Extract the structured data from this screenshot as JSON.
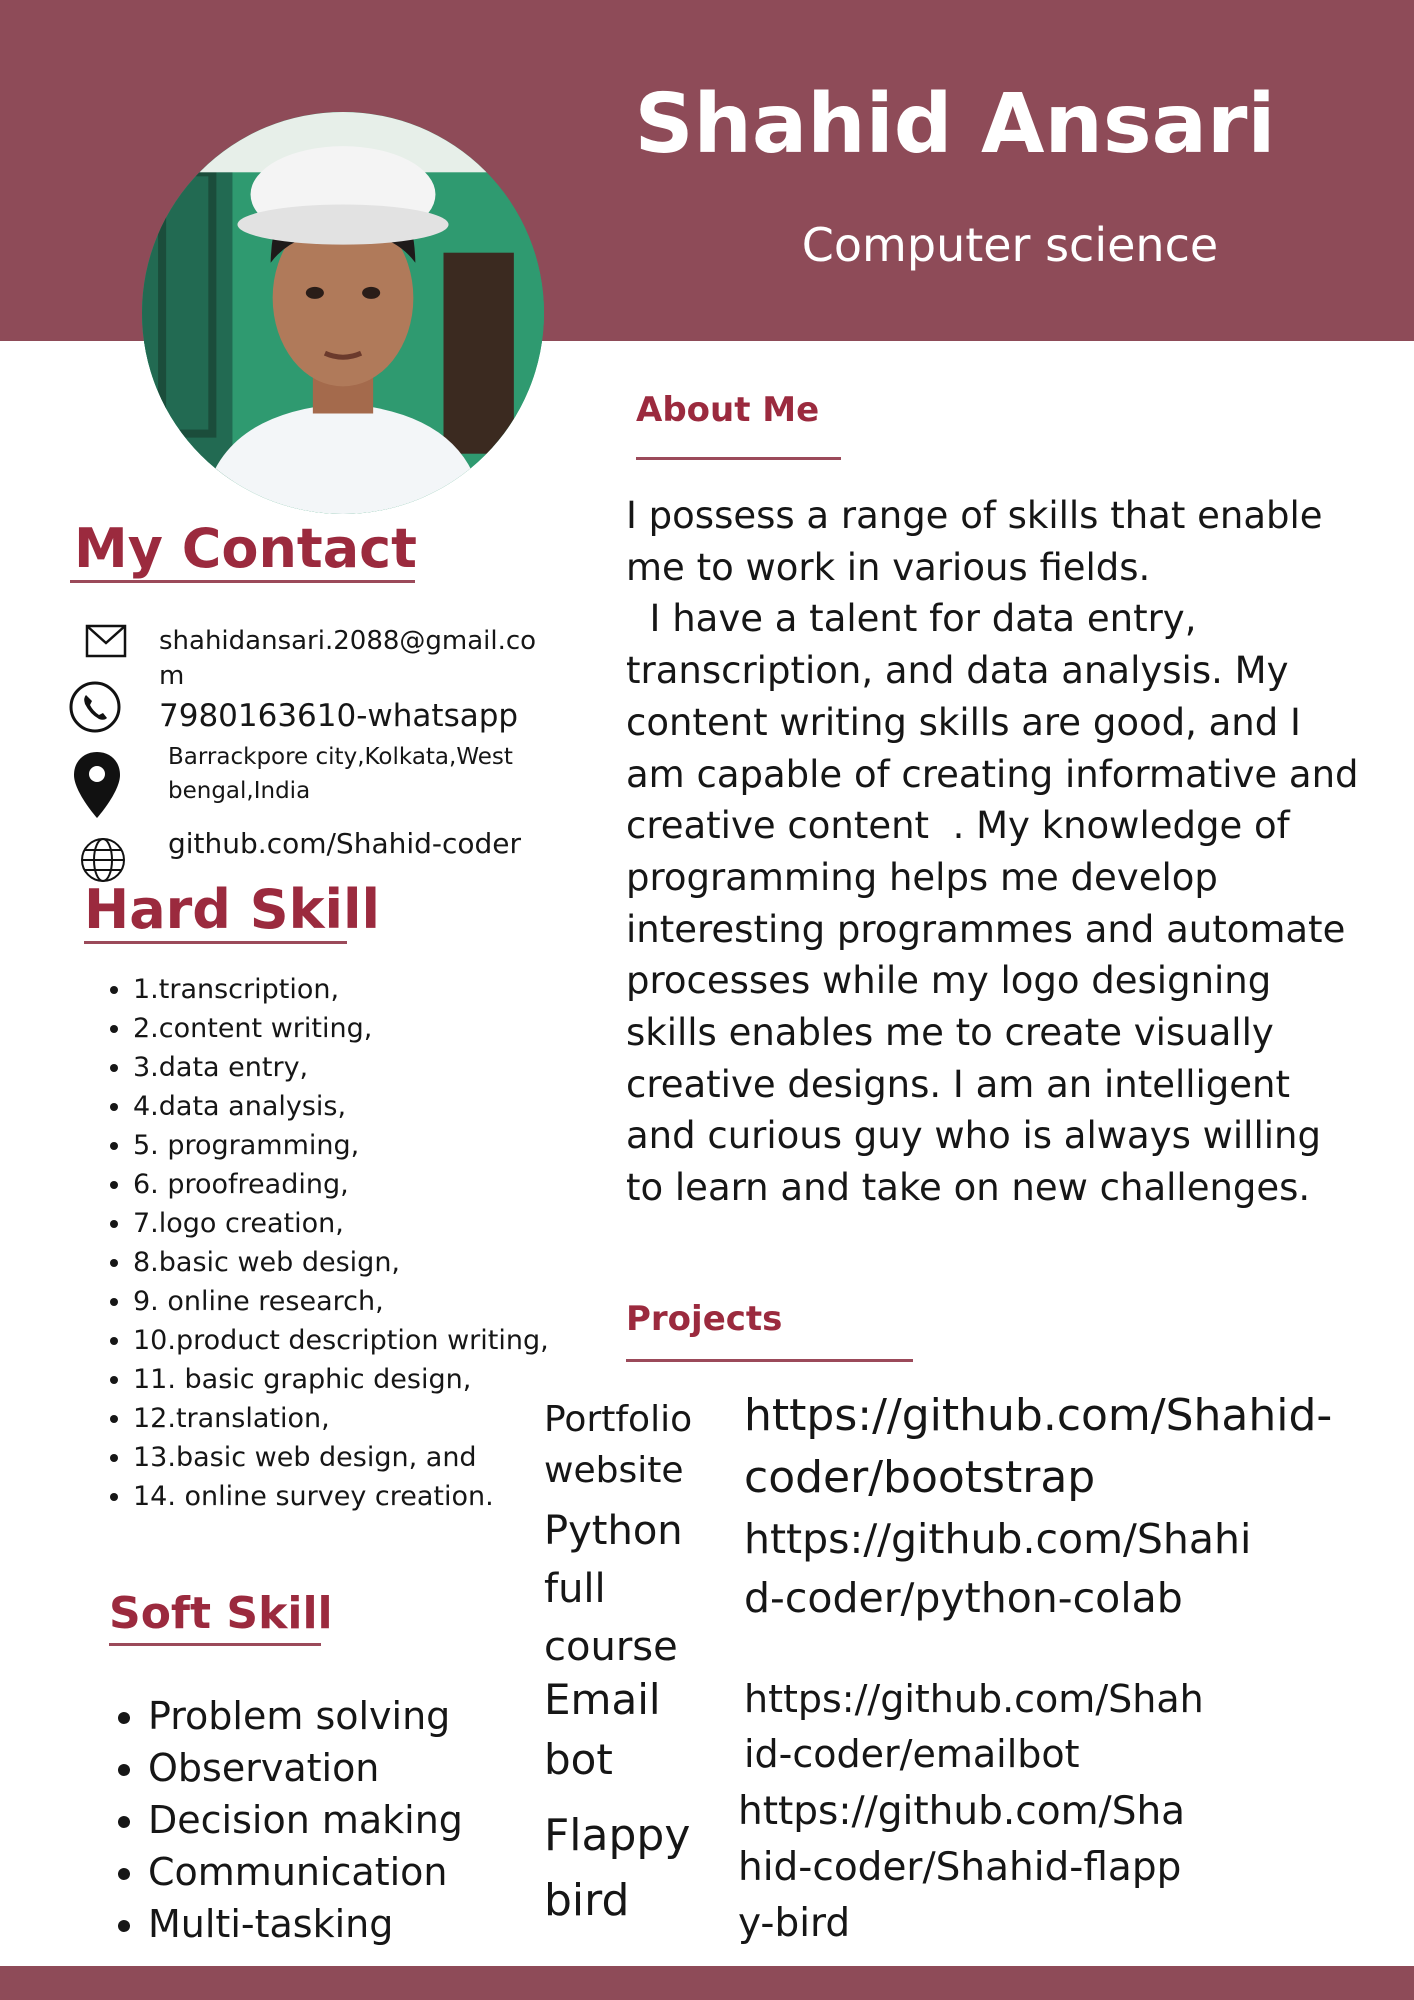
{
  "header": {
    "name": "Shahid Ansari",
    "title": "Computer science"
  },
  "colors": {
    "accent": "#8e4b58",
    "heading": "#9b2a3e"
  },
  "contact": {
    "heading": "My Contact",
    "email": "shahidansari.2088@gmail.com",
    "phone": "7980163610-whatsapp",
    "address": "Barrackpore city,Kolkata,West bengal,India",
    "website": "github.com/Shahid-coder",
    "icons": [
      "mail-icon",
      "phone-icon",
      "location-pin-icon",
      "globe-icon"
    ]
  },
  "hard_skill": {
    "heading": "Hard Skill",
    "items": [
      "1.transcription,",
      "2.content writing,",
      "3.data entry,",
      "4.data analysis,",
      "5. programming,",
      "6. proofreading,",
      "7.logo creation,",
      "8.basic web design,",
      "9. online research,",
      "10.product description writing,",
      "11. basic graphic design,",
      "12.translation,",
      "13.basic web design, and",
      "14. online survey creation."
    ]
  },
  "soft_skill": {
    "heading": "Soft Skill",
    "items": [
      "Problem solving",
      "Observation",
      "Decision making",
      "Communication",
      "Multi-tasking"
    ]
  },
  "about": {
    "heading": "About Me",
    "text": "I possess a range of skills that enable me to work in various fields.\n  I have a talent for data entry, transcription, and data analysis. My content writing skills are good, and I am capable of creating informative and creative content  . My knowledge of programming helps me develop interesting programmes and automate processes while my logo designing skills enables me to create visually creative designs. I am an intelligent and curious guy who is always willing to learn and take on new challenges."
  },
  "projects": {
    "heading": "Projects",
    "items": [
      {
        "name": "Portfolio website",
        "link": "https://github.com/Shahid-coder/bootstrap"
      },
      {
        "name": "Python full course",
        "link": "https://github.com/Shahid-coder/python-colab"
      },
      {
        "name": "Email bot",
        "link": "https://github.com/Shahid-coder/emailbot"
      },
      {
        "name": "Flappy bird",
        "link": "https://github.com/Shahid-coder/Shahid-flappy-bird"
      }
    ]
  }
}
